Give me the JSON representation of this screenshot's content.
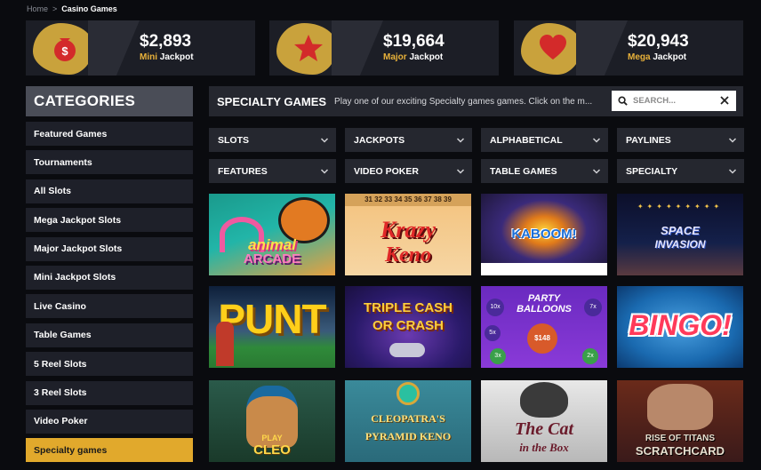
{
  "breadcrumb": {
    "home": "Home",
    "separator": ">",
    "current": "Casino Games"
  },
  "jackpots": [
    {
      "amount": "$2,893",
      "tier": "Mini",
      "suffix": "Jackpot",
      "icon": "money-bag-icon"
    },
    {
      "amount": "$19,664",
      "tier": "Major",
      "suffix": "Jackpot",
      "icon": "star-icon"
    },
    {
      "amount": "$20,943",
      "tier": "Mega",
      "suffix": "Jackpot",
      "icon": "heart-icon"
    }
  ],
  "categories": {
    "title": "CATEGORIES",
    "items": [
      "Featured Games",
      "Tournaments",
      "All Slots",
      "Mega Jackpot Slots",
      "Major Jackpot Slots",
      "Mini Jackpot Slots",
      "Live Casino",
      "Table Games",
      "5 Reel Slots",
      "3 Reel Slots",
      "Video Poker",
      "Specialty games"
    ],
    "active": "Specialty games"
  },
  "main": {
    "title": "SPECIALTY GAMES",
    "description": "Play one of our exciting Specialty games games. Click on the m...",
    "search_placeholder": "SEARCH..."
  },
  "filters": [
    "SLOTS",
    "JACKPOTS",
    "ALPHABETICAL",
    "PAYLINES",
    "FEATURES",
    "VIDEO POKER",
    "TABLE GAMES",
    "SPECIALTY"
  ],
  "games": [
    {
      "l1": "animal",
      "l2": "ARCADE"
    },
    {
      "l1": "Krazy",
      "l2": "Keno",
      "nums": "31 32 33 34 35 36 37 38 39"
    },
    {
      "l1": "KABOOM!",
      "l2": ""
    },
    {
      "l1": "SPACE",
      "l2": "INVASION"
    },
    {
      "l1": "PUNT",
      "l2": ""
    },
    {
      "l1": "TRIPLE CASH",
      "l2": "OR CRASH"
    },
    {
      "l1": "PARTY",
      "l2": "BALLOONS",
      "badges": [
        "10x",
        "7x",
        "5x",
        "$148",
        "3x",
        "2x"
      ]
    },
    {
      "l1": "BINGO!",
      "l2": ""
    },
    {
      "l1": "PLAY",
      "l2": "CLEO"
    },
    {
      "l1": "CLEOPATRA'S",
      "l2": "PYRAMID KENO"
    },
    {
      "l1": "The Cat",
      "l2": "in the Box"
    },
    {
      "l1": "RISE OF TITANS",
      "l2": "SCRATCHCARD"
    }
  ],
  "colors": {
    "accent": "#e1a92c",
    "panel": "#1e2029",
    "header": "#4a4d57",
    "jackpot_blob": "#c9a23c",
    "icon_red": "#d32a2a"
  }
}
